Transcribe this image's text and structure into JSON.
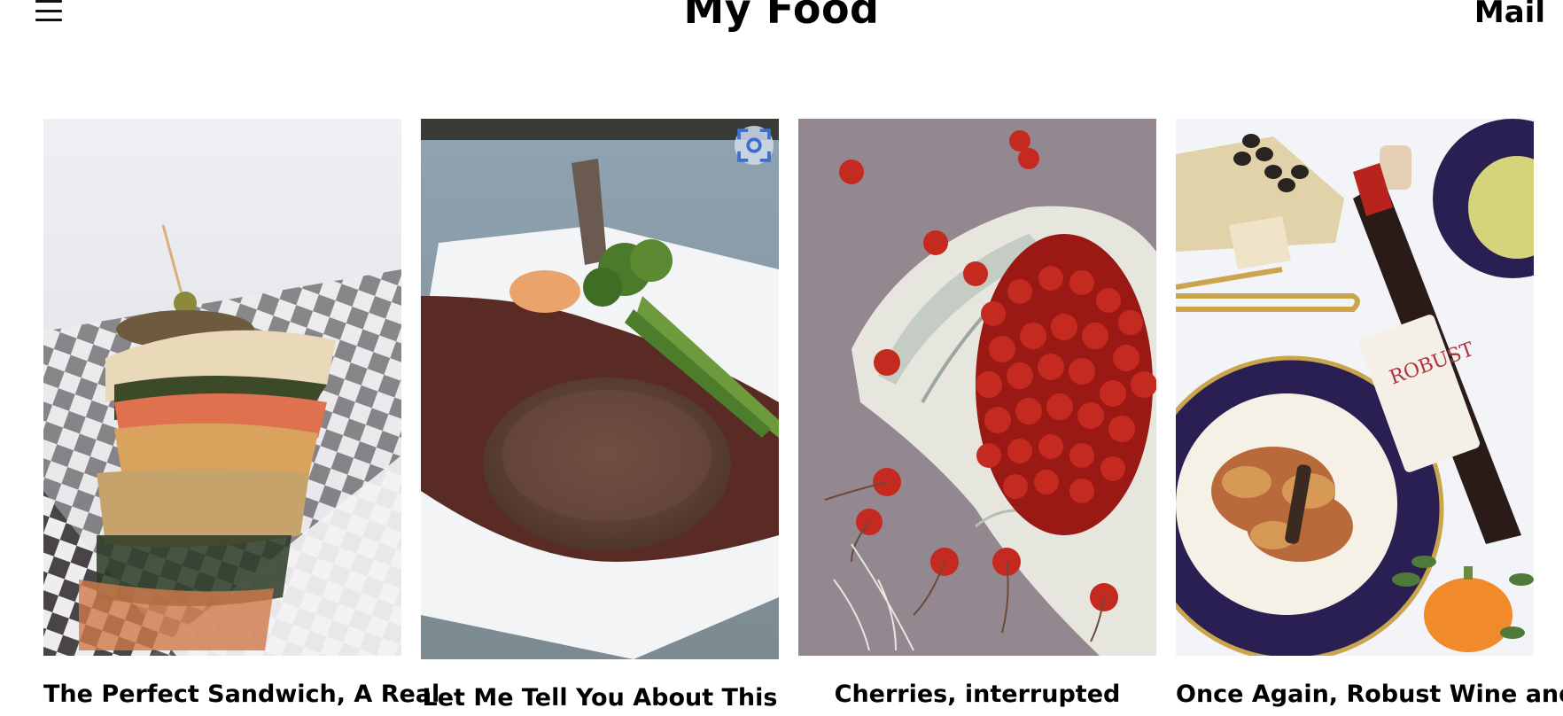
{
  "header": {
    "menu_icon": "hamburger-menu-icon",
    "title": "My Food",
    "mail_label": "Mail"
  },
  "posts": [
    {
      "title": "The Perfect Sandwich, A Real",
      "image": "sandwich-photo"
    },
    {
      "title": "Let Me Tell You About This",
      "image": "steak-photo"
    },
    {
      "title": "Cherries, interrupted",
      "image": "cherries-photo"
    },
    {
      "title": "Once Again, Robust Wine and",
      "image": "wine-pasta-photo"
    }
  ],
  "overlay": {
    "icon": "visual-search-icon"
  },
  "wine_label": {
    "brand": "ROBUST"
  },
  "colors": {
    "background": "#ffffff",
    "text": "#000000",
    "lens_accent": "#3b6fd1"
  }
}
